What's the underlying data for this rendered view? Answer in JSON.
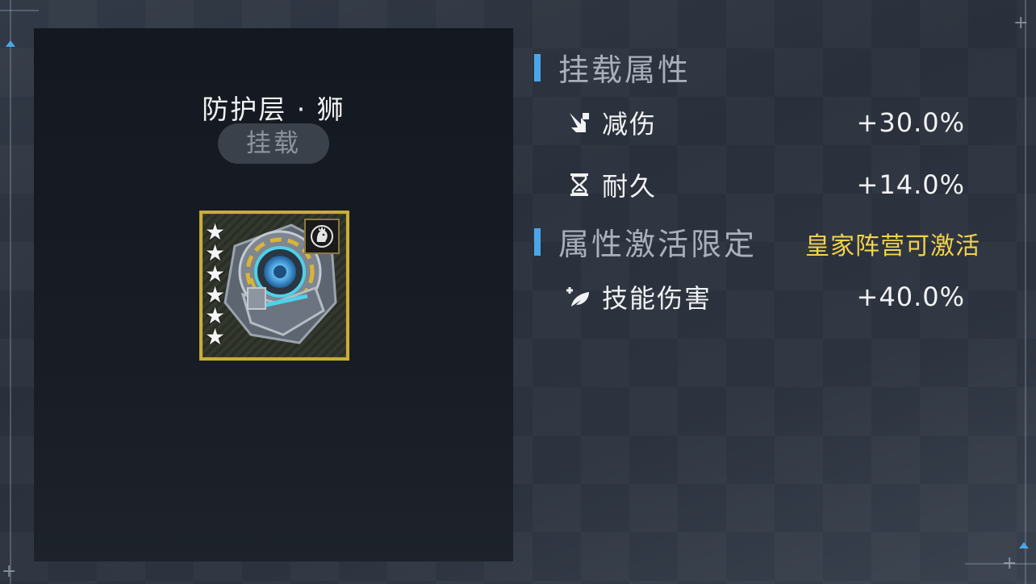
{
  "item": {
    "title": "防护层 · 狮",
    "status_label": "挂载",
    "star_count": 6,
    "star_glyph": "★",
    "frame_color": "#c9ad36"
  },
  "mount_attributes": {
    "header": "挂载属性",
    "stats": [
      {
        "icon": "damage-reduction-icon",
        "name": "减伤",
        "value": "+30.0%"
      },
      {
        "icon": "hourglass-icon",
        "name": "耐久",
        "value": "+14.0%"
      }
    ]
  },
  "activation": {
    "header": "属性激活限定",
    "condition": "皇家阵营可激活",
    "condition_color": "#f2d34a",
    "stats": [
      {
        "icon": "skill-damage-icon",
        "name": "技能伤害",
        "value": "+40.0%"
      }
    ]
  },
  "colors": {
    "section_accent": "#4aa6e8"
  }
}
